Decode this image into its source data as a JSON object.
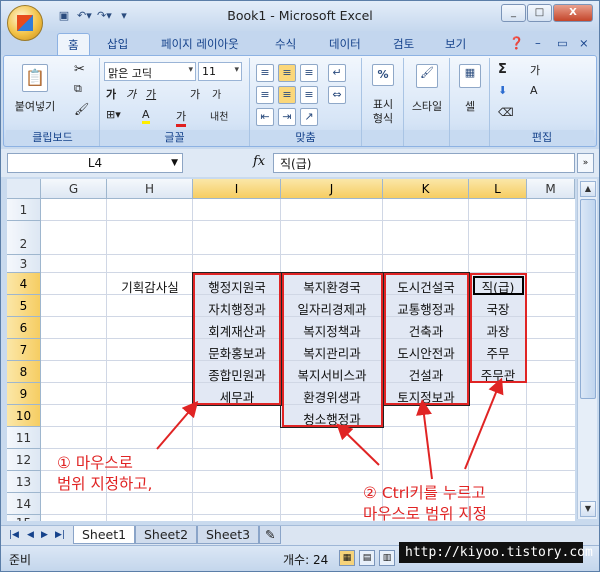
{
  "window": {
    "title": "Book1 - Microsoft Excel",
    "controls": [
      "_",
      "□",
      "X"
    ]
  },
  "qat": [
    "save-icon",
    "undo-icon",
    "redo-icon",
    "customize-icon"
  ],
  "tabs": [
    "홈",
    "삽입",
    "페이지 레이아웃",
    "수식",
    "데이터",
    "검토",
    "보기"
  ],
  "ribbon": {
    "clipboard": {
      "paste": "붙여넣기",
      "label": "클립보드"
    },
    "font": {
      "name": "맑은 고딕",
      "size": "11",
      "bold": "가",
      "italic": "가",
      "underline": "가",
      "grow": "가",
      "shrink": "가",
      "phonetic": "내천",
      "fill": "A",
      "color": "가",
      "label": "글꼴"
    },
    "align": {
      "label": "맞춤"
    },
    "number": {
      "percent": "%",
      "format": "표시\n형식",
      "label": ""
    },
    "styles": {
      "style": "스타일"
    },
    "cells": {
      "cell": "셀"
    },
    "editing": {
      "sum": "Σ",
      "sort": "가",
      "find": "A",
      "label": "편집"
    }
  },
  "formula": {
    "namebox": "L4",
    "fx": "fx",
    "value": "직(급)"
  },
  "columns": [
    "G",
    "H",
    "I",
    "J",
    "K",
    "L",
    "M"
  ],
  "rows": [
    "1",
    "2",
    "3",
    "4",
    "5",
    "6",
    "7",
    "8",
    "9",
    "10",
    "11",
    "12",
    "13",
    "14",
    "15"
  ],
  "cells": {
    "H4": "기획감사실",
    "I": [
      "행정지원국",
      "자치행정과",
      "회계재산과",
      "문화홍보과",
      "종합민원과",
      "세무과"
    ],
    "J": [
      "복지환경국",
      "일자리경제과",
      "복지정책과",
      "복지관리과",
      "복지서비스과",
      "환경위생과",
      "청소행정과"
    ],
    "K": [
      "도시건설국",
      "교통행정과",
      "건축과",
      "도시안전과",
      "건설과",
      "토지정보과"
    ],
    "L": [
      "직(급)",
      "국장",
      "과장",
      "주무",
      "주무관"
    ]
  },
  "annotations": {
    "a1": "① 마우스로\n범위 지정하고,",
    "a2": "② Ctrl키를 누르고\n마우스로 범위 지정"
  },
  "sheets": [
    "Sheet1",
    "Sheet2",
    "Sheet3"
  ],
  "status": {
    "ready": "준비",
    "count": "개수: 24"
  },
  "watermark": "http://kiyoo.tistory.com"
}
